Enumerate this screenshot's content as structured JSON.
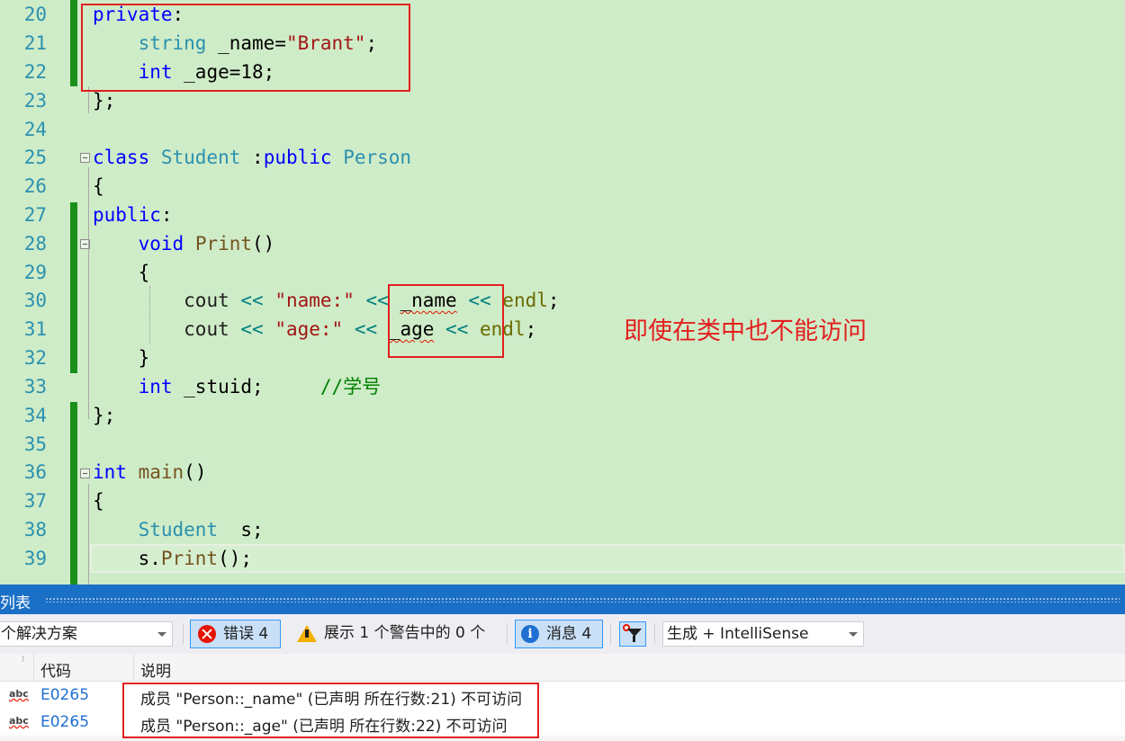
{
  "editor": {
    "lines": [
      {
        "n": "20",
        "t": "private:"
      },
      {
        "n": "21",
        "t": "    string _name=\"Brant\";"
      },
      {
        "n": "22",
        "t": "    int _age=18;"
      },
      {
        "n": "23",
        "t": "};"
      },
      {
        "n": "24",
        "t": ""
      },
      {
        "n": "25",
        "t": "class Student :public Person"
      },
      {
        "n": "26",
        "t": "{"
      },
      {
        "n": "27",
        "t": "public:"
      },
      {
        "n": "28",
        "t": "    void Print()"
      },
      {
        "n": "29",
        "t": "    {"
      },
      {
        "n": "30",
        "t": "        cout << \"name:\" << _name << endl;"
      },
      {
        "n": "31",
        "t": "        cout << \"age:\" << _age << endl;"
      },
      {
        "n": "32",
        "t": "    }"
      },
      {
        "n": "33",
        "t": "    int _stuid;     //学号"
      },
      {
        "n": "34",
        "t": "};"
      },
      {
        "n": "35",
        "t": ""
      },
      {
        "n": "36",
        "t": "int main()"
      },
      {
        "n": "37",
        "t": "{"
      },
      {
        "n": "38",
        "t": "    Student  s;"
      },
      {
        "n": "39",
        "t": "    s.Print();"
      }
    ],
    "annotation": "即使在类中也不能访问"
  },
  "panel": {
    "title": "列表",
    "scope_combo": "个解决方案",
    "errors_button": "错误 4",
    "warnings_button": "展示 1 个警告中的 0 个",
    "messages_button": "消息 4",
    "build_combo": "生成 + IntelliSense",
    "columns": {
      "code": "代码",
      "description": "说明"
    },
    "rows": [
      {
        "icon": "abc",
        "code": "E0265",
        "description": "成员 \"Person::_name\" (已声明 所在行数:21) 不可访问"
      },
      {
        "icon": "abc",
        "code": "E0265",
        "description": "成员 \"Person::_age\" (已声明 所在行数:22) 不可访问"
      }
    ]
  },
  "colors": {
    "editor_bg": "#cfecc8",
    "keyword": "#0000ff",
    "type": "#2b91af",
    "string": "#a31515",
    "comment": "#008000",
    "annotation": "#e21f1f",
    "panel_title": "#1a6fc6"
  }
}
